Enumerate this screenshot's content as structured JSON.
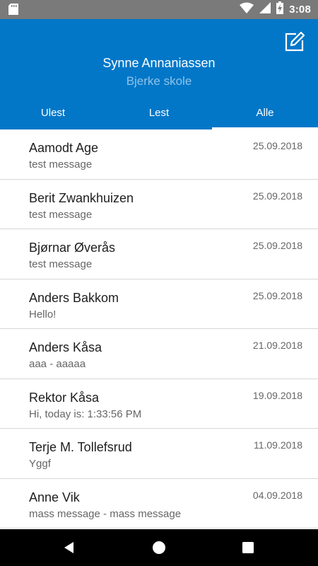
{
  "status_bar": {
    "time": "3:08",
    "icons": [
      "sd-card-icon",
      "wifi-icon",
      "signal-icon",
      "battery-charging-icon"
    ]
  },
  "header": {
    "user_name": "Synne Annaniassen",
    "school": "Bjerke skole",
    "compose_icon": "compose-icon",
    "background_color": "#0277c8"
  },
  "tabs": [
    {
      "label": "Ulest"
    },
    {
      "label": "Lest"
    },
    {
      "label": "Alle"
    }
  ],
  "messages": [
    {
      "sender": "Aamodt Age",
      "preview": "test message",
      "date": "25.09.2018"
    },
    {
      "sender": "Berit Zwankhuizen",
      "preview": "test message",
      "date": "25.09.2018"
    },
    {
      "sender": "Bjørnar Øverås",
      "preview": "test message",
      "date": "25.09.2018"
    },
    {
      "sender": "Anders Bakkom",
      "preview": "Hello!",
      "date": "25.09.2018"
    },
    {
      "sender": "Anders Kåsa",
      "preview": "aaa - aaaaa",
      "date": "21.09.2018"
    },
    {
      "sender": "Rektor Kåsa",
      "preview": "Hi, today is: 1:33:56 PM",
      "date": "19.09.2018"
    },
    {
      "sender": "Terje M. Tollefsrud",
      "preview": "Yggf",
      "date": "11.09.2018"
    },
    {
      "sender": "Anne Vik",
      "preview": "mass message - mass message",
      "date": "04.09.2018"
    }
  ],
  "nav_bar": {
    "buttons": [
      "back-icon",
      "home-icon",
      "recents-icon"
    ]
  }
}
